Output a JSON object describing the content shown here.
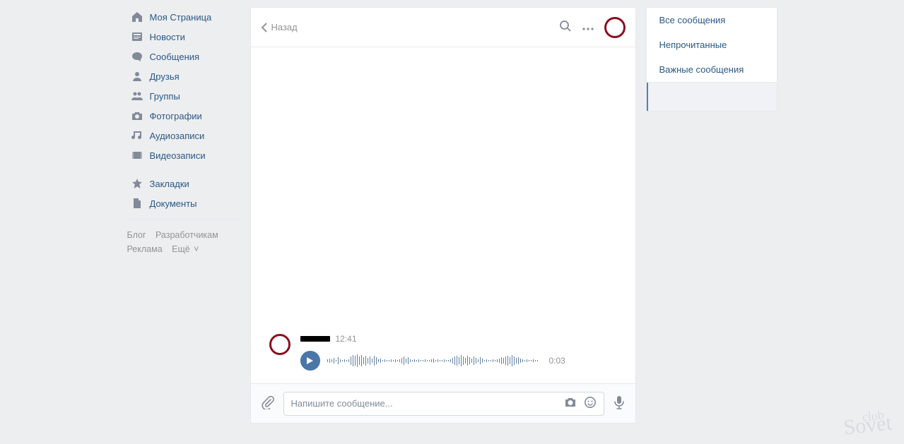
{
  "nav": {
    "items": [
      {
        "icon": "home",
        "label": "Моя Страница"
      },
      {
        "icon": "news",
        "label": "Новости"
      },
      {
        "icon": "message",
        "label": "Сообщения"
      },
      {
        "icon": "friends",
        "label": "Друзья"
      },
      {
        "icon": "groups",
        "label": "Группы"
      },
      {
        "icon": "photos",
        "label": "Фотографии"
      },
      {
        "icon": "audio",
        "label": "Аудиозаписи"
      },
      {
        "icon": "video",
        "label": "Видеозаписи"
      }
    ],
    "items2": [
      {
        "icon": "bookmark",
        "label": "Закладки"
      },
      {
        "icon": "docs",
        "label": "Документы"
      }
    ]
  },
  "footer": {
    "blog": "Блог",
    "dev": "Разработчикам",
    "ads": "Реклама",
    "more": "Ещё"
  },
  "chat": {
    "back": "Назад",
    "title": "",
    "message": {
      "time": "12:41",
      "voice_duration": "0:03"
    },
    "input_placeholder": "Напишите сообщение..."
  },
  "filters": {
    "all": "Все сообщения",
    "unread": "Непрочитанные",
    "important": "Важные сообщения",
    "active": ""
  },
  "watermark": {
    "top": "club",
    "bottom": "Sovet"
  }
}
